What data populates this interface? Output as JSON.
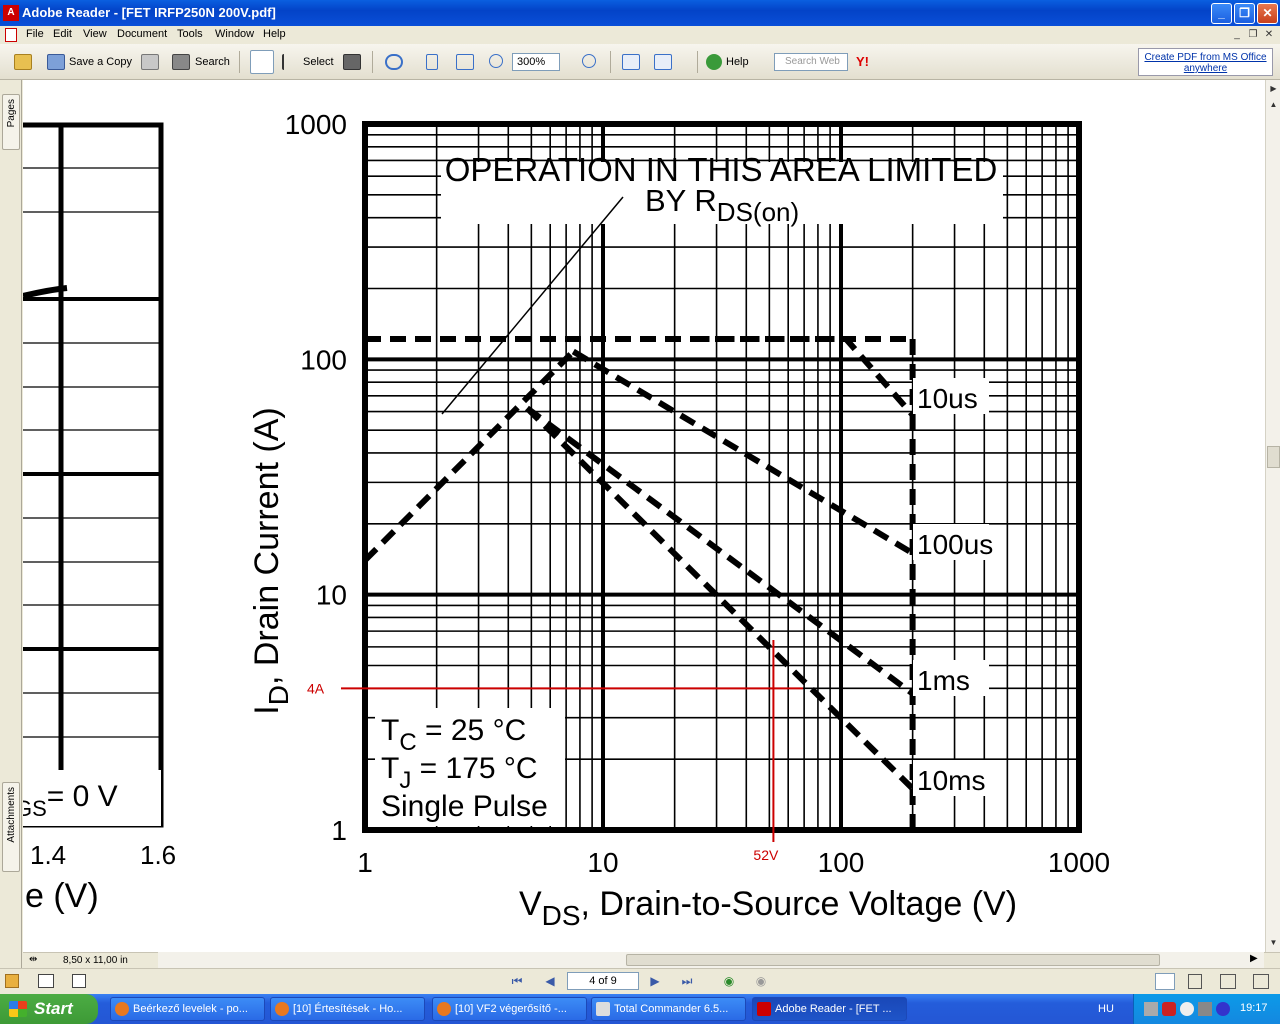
{
  "window": {
    "title": "Adobe Reader - [FET IRFP250N 200V.pdf]",
    "app_icon": "A",
    "buttons": [
      "_",
      "❐",
      "✕"
    ]
  },
  "menu": [
    "File",
    "Edit",
    "View",
    "Document",
    "Tools",
    "Window",
    "Help"
  ],
  "toolbar": {
    "save_copy": "Save a Copy",
    "search": "Search",
    "select": "Select",
    "zoom_value": "300%",
    "help": "Help",
    "search_web_placeholder": "Search Web",
    "create_pdf": "Create PDF from MS Office anywhere"
  },
  "side_tabs": {
    "pages": "Pages",
    "attachments": "Attachments"
  },
  "status": {
    "page_size": "8,50 x 11,00 in"
  },
  "navigation": {
    "page_display": "4 of 9"
  },
  "left_graph": {
    "tick_labels": [
      "1.4",
      "1.6"
    ],
    "axis_fragment": "e (V)",
    "legend_fragment_prefix": "GS",
    "legend_fragment_suffix": "= 0 V"
  },
  "chart_data": {
    "type": "line",
    "scale": "log-log",
    "xlabel": "V",
    "xlabel_sub": "DS",
    "xlabel_rest": ", Drain-to-Source Voltage (V)",
    "ylabel": "I",
    "ylabel_sub": "D",
    "ylabel_rest": ", Drain Current (A)",
    "xlim": [
      1,
      1000
    ],
    "ylim": [
      1,
      1000
    ],
    "x_ticks": [
      "1",
      "10",
      "100",
      "1000"
    ],
    "y_ticks": [
      "1",
      "10",
      "100",
      "1000"
    ],
    "annotation_top_line1": "OPERATION IN THIS AREA LIMITED",
    "annotation_top_line2": "BY R",
    "annotation_top_sub": "DS(on)",
    "conditions": [
      {
        "main": "T",
        "sub": "C",
        "rest": "= 25 °C"
      },
      {
        "main": "T",
        "sub": "J",
        "rest": "= 175 °C"
      },
      {
        "main": "Single Pulse",
        "sub": "",
        "rest": ""
      }
    ],
    "series": [
      {
        "name": "10us",
        "values": [
          [
            24,
            122
          ],
          [
            105,
            122
          ],
          [
            200,
            58
          ]
        ]
      },
      {
        "name": "100us",
        "values": [
          [
            7.5,
            108
          ],
          [
            200,
            15
          ]
        ]
      },
      {
        "name": "1ms",
        "values": [
          [
            4.8,
            62
          ],
          [
            200,
            3.8
          ]
        ]
      },
      {
        "name": "10ms",
        "values": [
          [
            200,
            1.5
          ]
        ]
      }
    ],
    "rdson_limit": [
      [
        1,
        14
      ],
      [
        7.5,
        108
      ]
    ],
    "current_limit": [
      [
        1,
        122
      ],
      [
        200,
        122
      ]
    ],
    "voltage_limit": [
      [
        200,
        1
      ],
      [
        200,
        122
      ]
    ],
    "markers": [
      {
        "label": "4A",
        "axis": "y",
        "value": 4
      },
      {
        "label": "52V",
        "axis": "x",
        "value": 52
      }
    ],
    "marker_color": "#cc0000"
  }
}
